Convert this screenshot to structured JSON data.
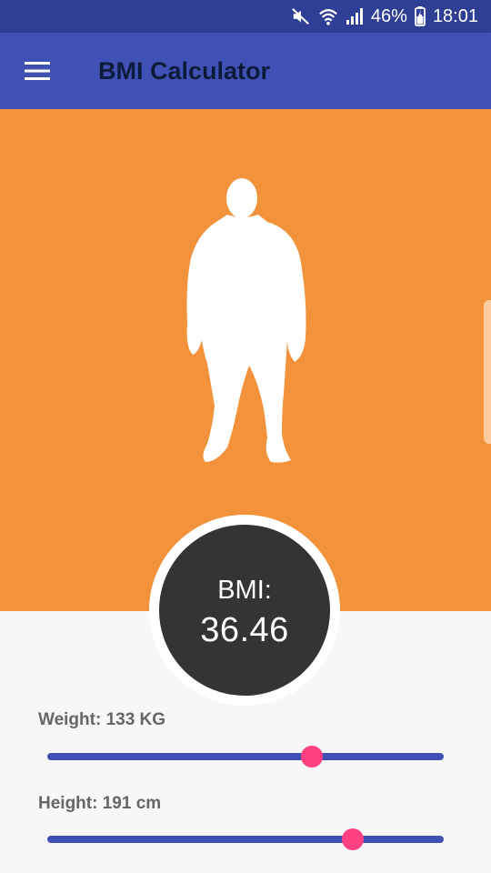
{
  "status_bar": {
    "battery": "46%",
    "time": "18:01",
    "icons": [
      "mute-icon",
      "wifi-icon",
      "signal-icon",
      "battery-icon"
    ]
  },
  "app_bar": {
    "menu_icon": "menu-icon",
    "title": "BMI Calculator",
    "color": "#3f51b5"
  },
  "hero": {
    "background_color": "#f2923a",
    "figure": "person-silhouette"
  },
  "bmi": {
    "label": "BMI:",
    "value": "36.46"
  },
  "weight": {
    "label": "Weight: 133 KG",
    "slider_fraction": 0.667
  },
  "height": {
    "label": "Height: 191 cm",
    "slider_fraction": 0.771
  },
  "colors": {
    "accent": "#ff4081",
    "track": "#3f51b5",
    "circle": "#343434"
  }
}
